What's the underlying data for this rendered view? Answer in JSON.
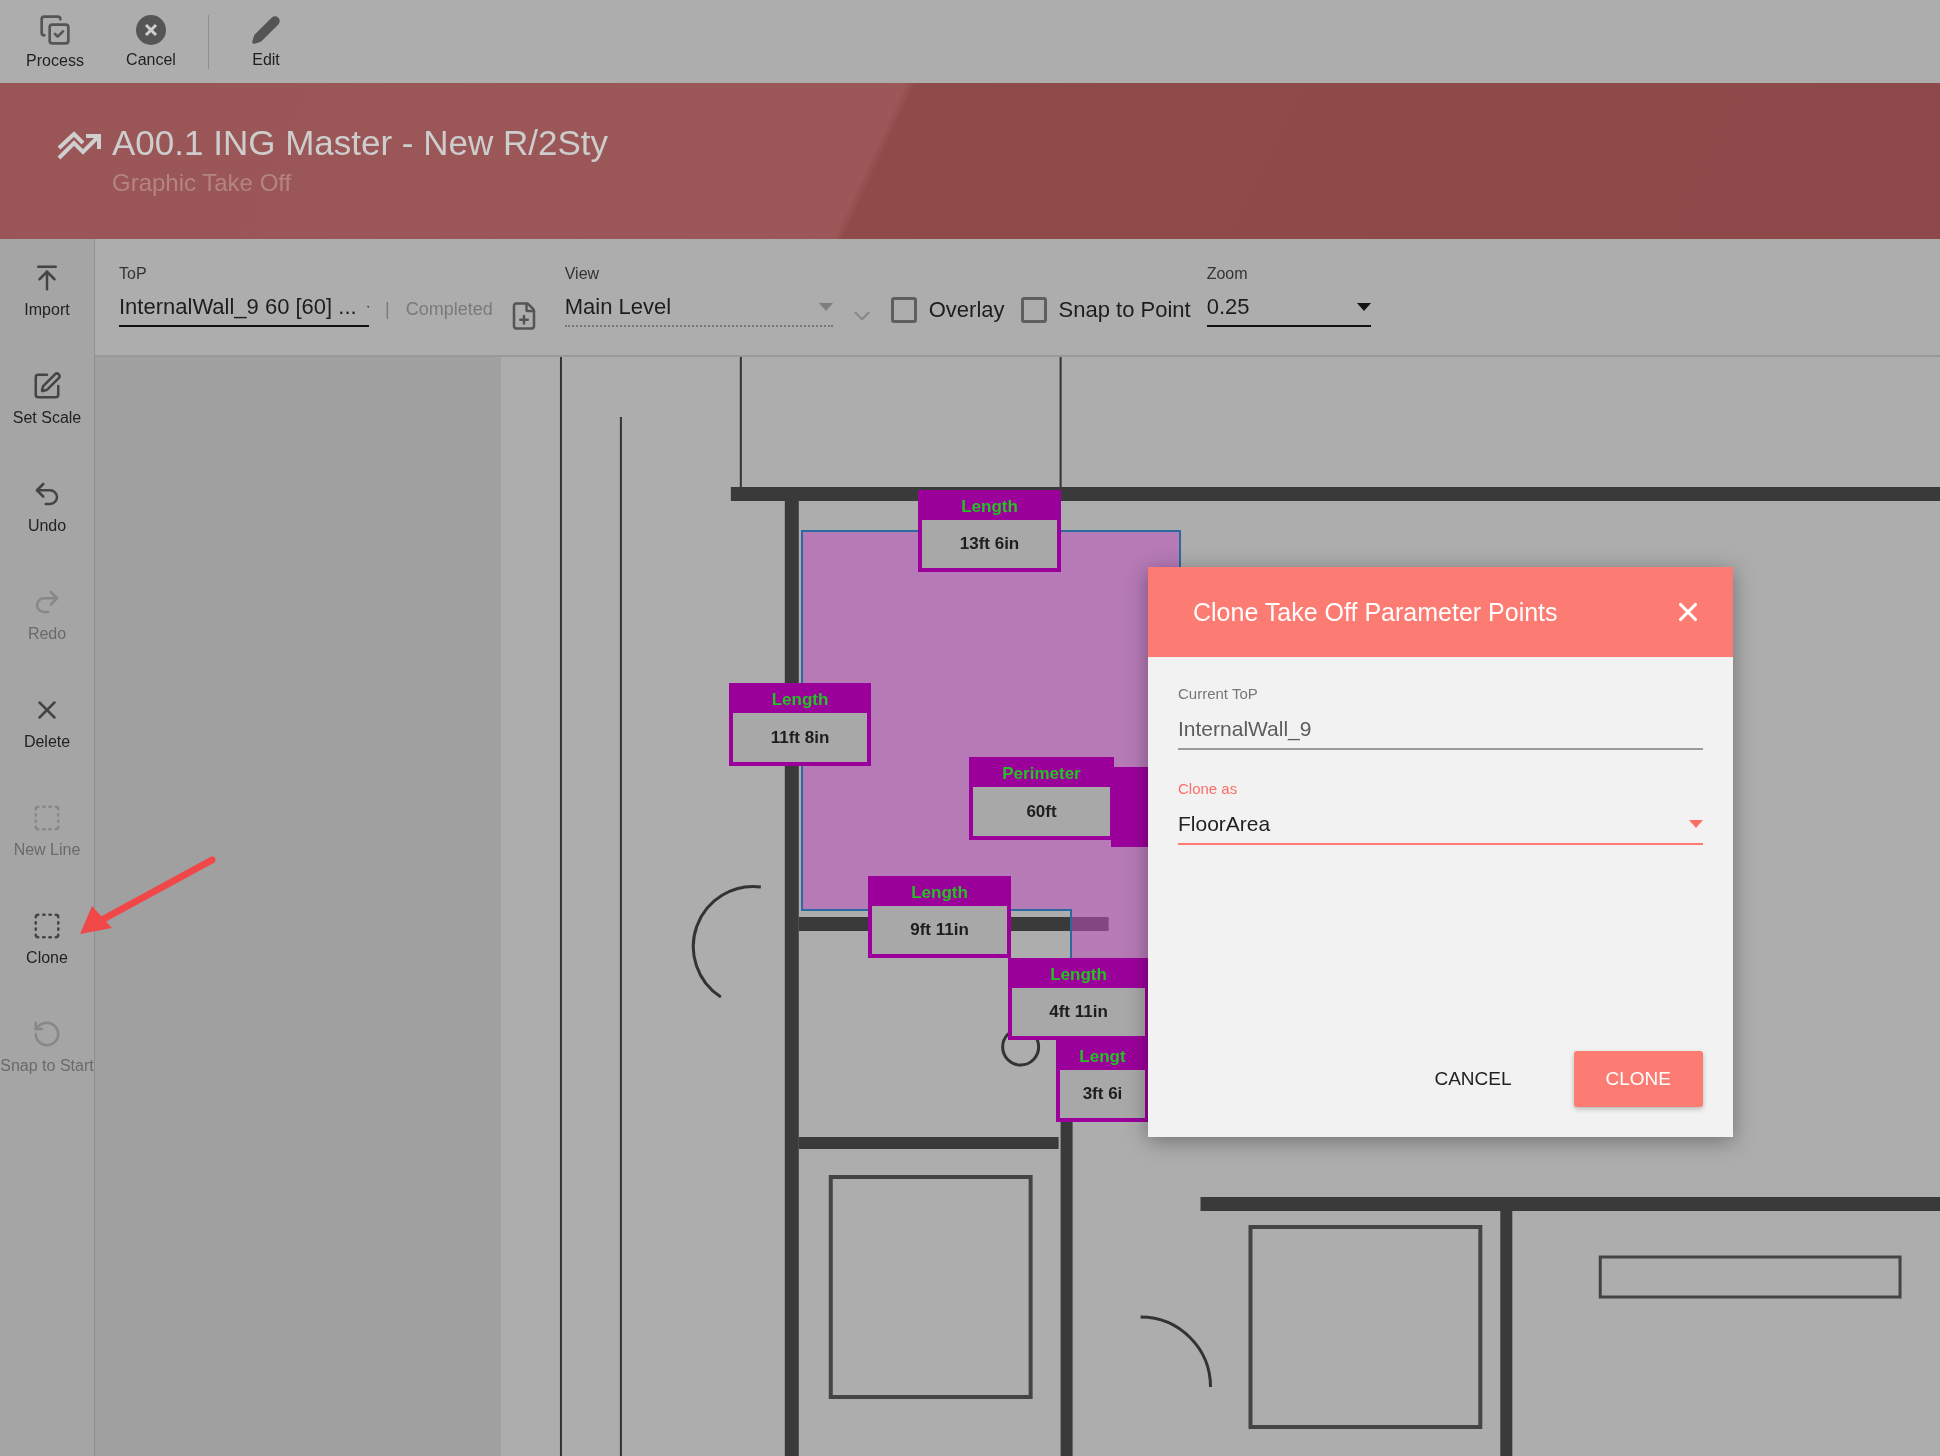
{
  "toolbar": [
    {
      "label": "Process",
      "kind": "process"
    },
    {
      "label": "Cancel",
      "kind": "cancel"
    },
    {
      "label": "Edit",
      "kind": "edit"
    }
  ],
  "header": {
    "title": "A00.1 ING Master - New R/2Sty",
    "subtitle": "Graphic Take Off"
  },
  "sidebar": {
    "items": [
      {
        "label": "Import",
        "kind": "import",
        "disabled": false
      },
      {
        "label": "Set Scale",
        "kind": "scale",
        "disabled": false
      },
      {
        "label": "Undo",
        "kind": "undo",
        "disabled": false
      },
      {
        "label": "Redo",
        "kind": "redo",
        "disabled": true
      },
      {
        "label": "Delete",
        "kind": "delete",
        "disabled": false
      },
      {
        "label": "New Line",
        "kind": "newline",
        "disabled": true
      },
      {
        "label": "Clone",
        "kind": "clone",
        "disabled": false
      },
      {
        "label": "Snap to Start",
        "kind": "snap",
        "disabled": true
      }
    ]
  },
  "controls": {
    "top": {
      "label": "ToP",
      "value": "InternalWall_9 60 [60] ..."
    },
    "separator": "|",
    "status": "Completed",
    "view": {
      "label": "View",
      "value": "Main Level"
    },
    "checkboxes": [
      {
        "label": "Overlay",
        "checked": false
      },
      {
        "label": "Snap to Point",
        "checked": false
      }
    ],
    "zoom": {
      "label": "Zoom",
      "value": "0.25"
    }
  },
  "measurements": [
    {
      "title": "Length",
      "value": "13ft 6in"
    },
    {
      "title": "Length",
      "value": "11ft 8in"
    },
    {
      "title": "Perimeter",
      "value": "60ft"
    },
    {
      "title": "Length",
      "value": "9ft 11in"
    },
    {
      "title": "Length",
      "value": "4ft 11in"
    },
    {
      "title": "Lengt",
      "value": "3ft 6i"
    }
  ],
  "dialog": {
    "title": "Clone Take Off Parameter Points",
    "fields": [
      {
        "label": "Current ToP",
        "value": "InternalWall_9",
        "kind": "readonly"
      },
      {
        "label": "Clone as",
        "value": "FloorArea",
        "kind": "select"
      }
    ],
    "buttons": [
      {
        "label": "CANCEL",
        "kind": "text"
      },
      {
        "label": "CLONE",
        "kind": "primary"
      }
    ]
  }
}
